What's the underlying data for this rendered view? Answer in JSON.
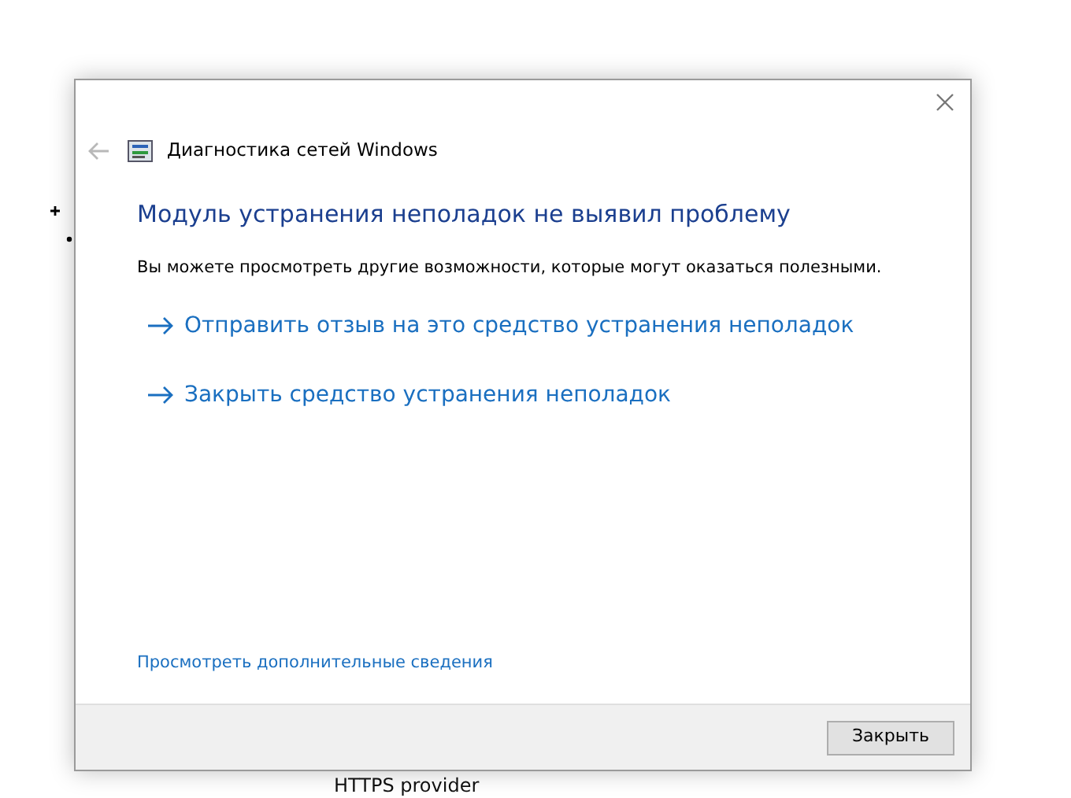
{
  "background_text": "HTTPS provider",
  "window": {
    "title": "Диагностика сетей Windows",
    "back_enabled": false
  },
  "heading": "Модуль устранения неполадок не выявил проблему",
  "description": "Вы можете просмотреть другие возможности, которые могут оказаться полезными.",
  "options": [
    {
      "label": "Отправить отзыв на это средство устранения неполадок"
    },
    {
      "label": "Закрыть средство устранения неполадок"
    }
  ],
  "details_link": "Просмотреть дополнительные сведения",
  "buttons": [
    "Закрыть"
  ]
}
